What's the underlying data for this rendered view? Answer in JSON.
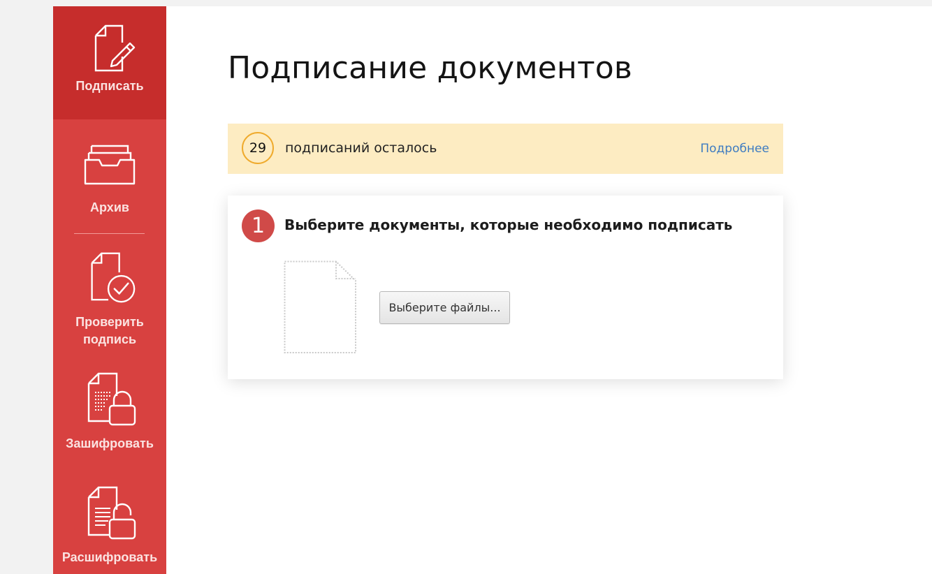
{
  "sidebar": {
    "items": [
      {
        "label": "Подписать",
        "icon": "sign-document-icon",
        "active": true
      },
      {
        "label": "Архив",
        "icon": "archive-tray-icon",
        "active": false
      },
      {
        "label": "Проверить подпись",
        "label_lines": [
          "Проверить",
          "подпись"
        ],
        "icon": "verify-signature-icon",
        "active": false
      },
      {
        "label": "Зашифровать",
        "icon": "encrypt-lock-icon",
        "active": false
      },
      {
        "label": "Расшифровать",
        "icon": "decrypt-unlock-icon",
        "active": false
      }
    ]
  },
  "main": {
    "title": "Подписание документов"
  },
  "quota": {
    "count": "29",
    "text": "подписаний осталось",
    "link": "Подробнее"
  },
  "step": {
    "number": "1",
    "title": "Выберите документы, которые необходимо подписать",
    "button_label": "Выберите файлы...",
    "placeholder_icon": "empty-document-icon"
  },
  "colors": {
    "sidebar_bg": "#d84140",
    "sidebar_active_bg": "#c62d2c",
    "banner_bg": "#fdecc2",
    "quota_ring": "#efaa2c",
    "link": "#3d7bc1",
    "step_badge": "#d04a48"
  }
}
